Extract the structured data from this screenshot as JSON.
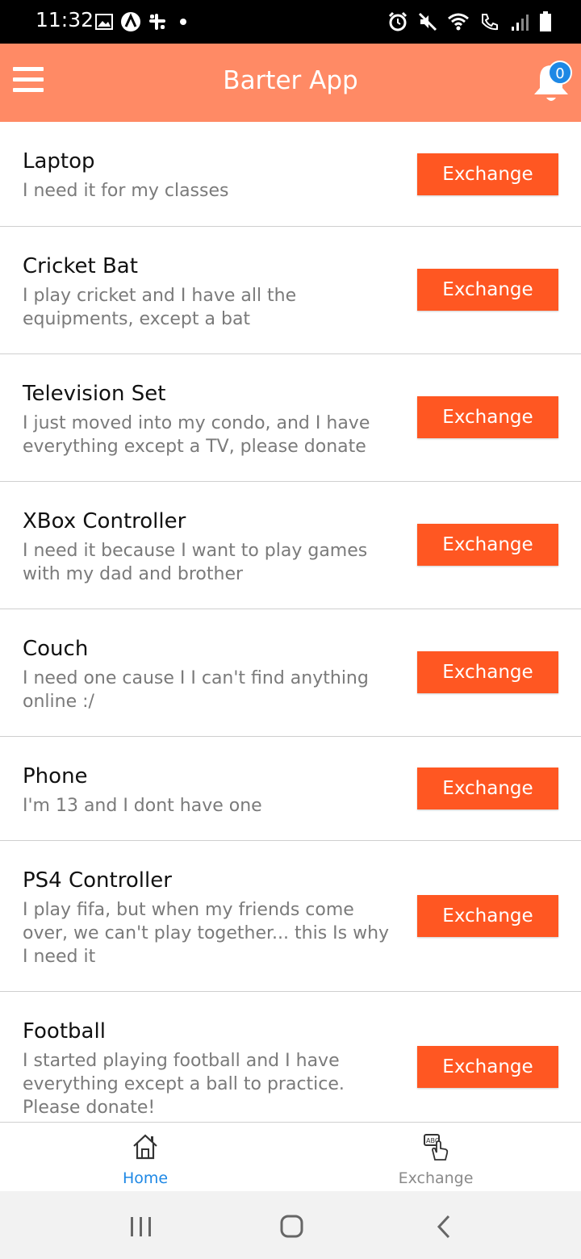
{
  "status_bar": {
    "time": "11:32",
    "icons_left": [
      "image-icon",
      "app-a-icon",
      "slack-icon",
      "dot-icon"
    ],
    "icons_right": [
      "alarm-icon",
      "mute-icon",
      "wifi-icon",
      "call-signal-icon",
      "signal-bars-icon",
      "battery-icon"
    ]
  },
  "header": {
    "title": "Barter App",
    "notification_count": "0",
    "colors": {
      "header_bg": "#ff8a65",
      "badge": "#1e88e5"
    }
  },
  "items": [
    {
      "title": "Laptop",
      "description": "I need it for my classes",
      "button": "Exchange"
    },
    {
      "title": "Cricket Bat",
      "description": "I play cricket and I have all the equipments, except a bat",
      "button": "Exchange"
    },
    {
      "title": "Television Set",
      "description": "I just moved into my condo, and I have everything except a TV, please donate",
      "button": "Exchange"
    },
    {
      "title": "XBox Controller",
      "description": "I need it because I want to play games with my dad and brother",
      "button": "Exchange"
    },
    {
      "title": "Couch",
      "description": "I need one cause I I can't find anything online :/",
      "button": "Exchange"
    },
    {
      "title": "Phone",
      "description": "I'm 13 and I dont have one",
      "button": "Exchange"
    },
    {
      "title": "PS4 Controller",
      "description": "I play fifa, but when my friends come over, we can't play together... this Is why I need it",
      "button": "Exchange"
    },
    {
      "title": "Football",
      "description": "I started playing football and I have everything except a ball to practice. Please donate!",
      "button": "Exchange"
    }
  ],
  "tabs": [
    {
      "label": "Home",
      "icon": "home-icon",
      "active": true,
      "color": "#1e88e5"
    },
    {
      "label": "Exchange",
      "icon": "exchange-icon",
      "active": false,
      "color": "#8a8a8a"
    }
  ],
  "nav_bar": [
    "recents-button",
    "home-button",
    "back-button"
  ],
  "colors": {
    "button": "#ff5722"
  }
}
